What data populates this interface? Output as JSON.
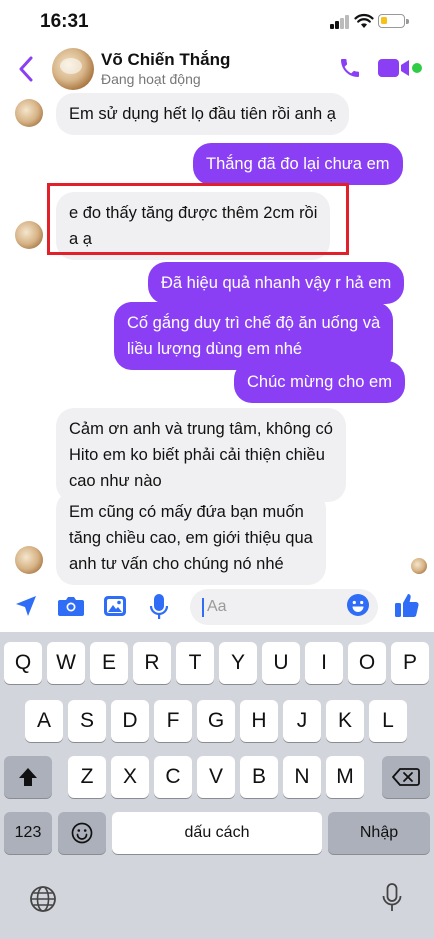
{
  "status_bar": {
    "time": "16:31"
  },
  "header": {
    "contact_name": "Võ Chiến Thắng",
    "status": "Đang hoạt động"
  },
  "messages": [
    {
      "direction": "in",
      "text": "Em sử dụng hết lọ đầu tiên rồi anh ạ"
    },
    {
      "direction": "out",
      "text": "Thắng đã đo lại chưa em"
    },
    {
      "direction": "in",
      "lines": [
        "e đo thấy tăng được thêm 2cm rồi",
        "a ạ"
      ],
      "highlighted": true
    },
    {
      "direction": "out",
      "text": "Đã hiệu quả nhanh vậy r hả em"
    },
    {
      "direction": "out",
      "lines": [
        "Cố gắng duy trì chế độ ăn uống và",
        "liều lượng dùng em nhé"
      ]
    },
    {
      "direction": "out",
      "text": "Chúc mừng cho em"
    },
    {
      "direction": "in",
      "lines": [
        "Cảm ơn anh và trung tâm, không có",
        "Hito em ko biết phải cải thiện chiều",
        "cao như nào"
      ]
    },
    {
      "direction": "in",
      "lines": [
        "Em cũng có mấy đứa bạn muốn",
        "tăng chiều cao, em giới thiệu qua",
        "anh tư vấn cho chúng nó nhé"
      ]
    }
  ],
  "composer": {
    "placeholder": "Aa"
  },
  "keyboard": {
    "row1": [
      "Q",
      "W",
      "E",
      "R",
      "T",
      "Y",
      "U",
      "I",
      "O",
      "P"
    ],
    "row2": [
      "A",
      "S",
      "D",
      "F",
      "G",
      "H",
      "J",
      "K",
      "L"
    ],
    "row3": [
      "Z",
      "X",
      "C",
      "V",
      "B",
      "N",
      "M"
    ],
    "numbers_key": "123",
    "space_key": "dấu cách",
    "return_key": "Nhập"
  },
  "colors": {
    "accent": "#8a3ff4",
    "incoming_bubble": "#f0f0f2",
    "highlight_border": "#e1202a",
    "online": "#31cc46"
  }
}
